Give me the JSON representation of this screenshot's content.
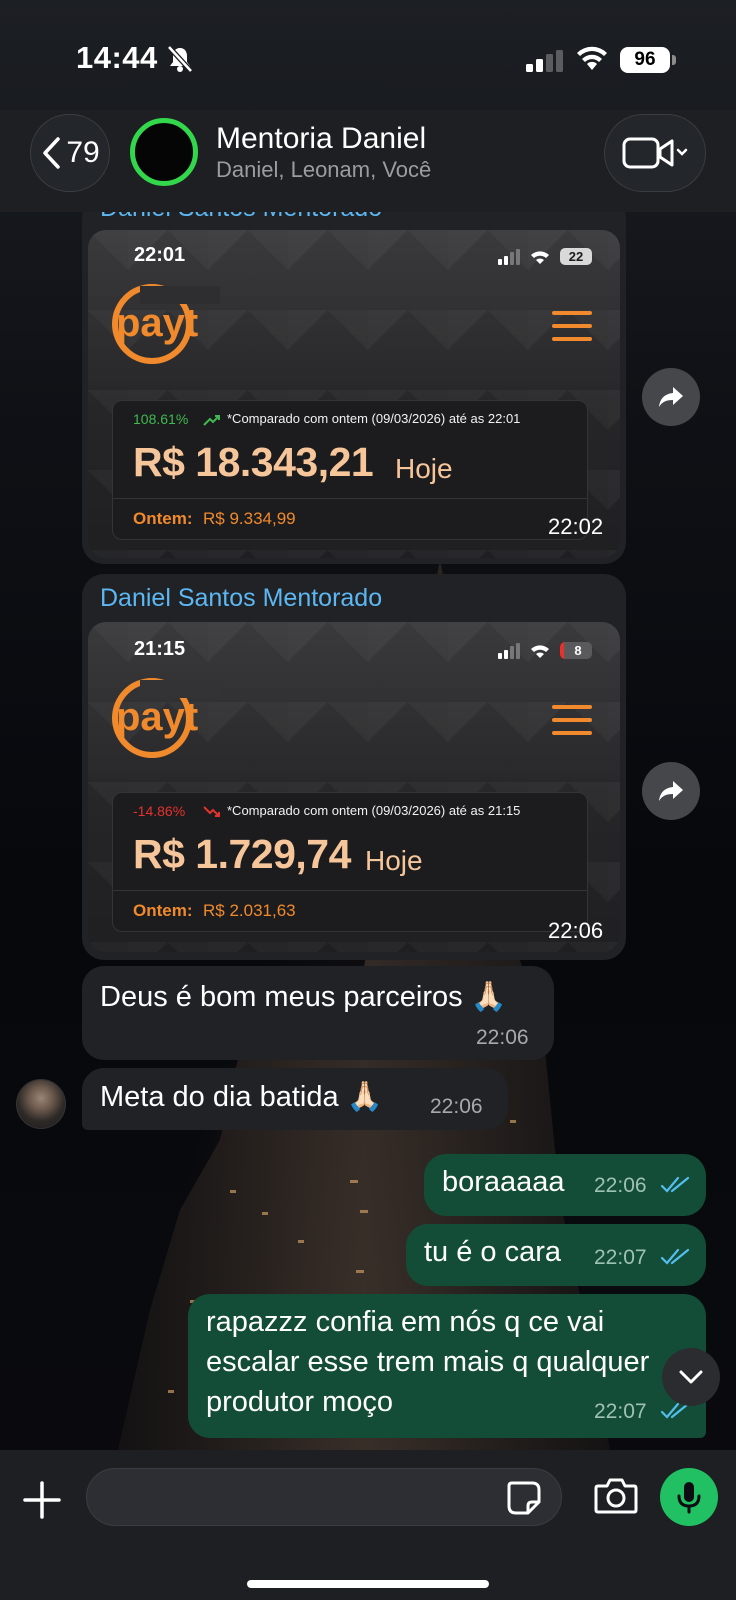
{
  "status_bar": {
    "time": "14:44",
    "battery": "96"
  },
  "header": {
    "back_count": "79",
    "title": "Mentoria Daniel",
    "members": "Daniel, Leonam, Você"
  },
  "messages": {
    "card1": {
      "sender_partial": "Daniel Santos Mentorado",
      "shot_time": "22:01",
      "shot_battery": "22",
      "logo": "payt",
      "pct": "108.61%",
      "pct_color": "#3fb950",
      "compare": "*Comparado com ontem (09/03/2026) até as 22:01",
      "amount": "R$ 18.343,21",
      "hoje": "Hoje",
      "ontem_label": "Ontem:",
      "ontem_value": "R$ 9.334,99",
      "time": "22:02"
    },
    "card2": {
      "sender": "Daniel Santos Mentorado",
      "shot_time": "21:15",
      "shot_battery": "8",
      "logo": "payt",
      "pct": "-14.86%",
      "pct_color": "#e5322d",
      "compare": "*Comparado com ontem (09/03/2026) até as 21:15",
      "amount": "R$ 1.729,74",
      "hoje": "Hoje",
      "ontem_label": "Ontem:",
      "ontem_value": "R$ 2.031,63",
      "time": "22:06"
    },
    "in1": {
      "text": "Deus é bom meus parceiros 🙏🏻",
      "time": "22:06"
    },
    "in2": {
      "text": "Meta do dia batida 🙏🏻",
      "time": "22:06"
    },
    "out1": {
      "text": "boraaaaa",
      "time": "22:06"
    },
    "out2": {
      "text": "tu é o cara",
      "time": "22:07"
    },
    "out3": {
      "line1": "rapazzz confia em nós q ce vai",
      "line2": "escalar esse trem mais q qualquer",
      "line3": "produtor moço",
      "time": "22:07"
    }
  },
  "input": {
    "placeholder": ""
  },
  "icons": {
    "back": "chevron-left-icon",
    "mute": "bell-slash-icon",
    "video": "video-camera-icon",
    "forward": "share-arrow-icon",
    "plus": "plus-icon",
    "sticker": "sticker-icon",
    "camera": "camera-icon",
    "mic": "microphone-icon",
    "scroll": "chevron-down-icon"
  },
  "colors": {
    "accent_green": "#21c063",
    "outgoing": "#134d37",
    "incoming": "#202226",
    "link_blue": "#5cb7f2",
    "payt_orange": "#f08a2c"
  }
}
